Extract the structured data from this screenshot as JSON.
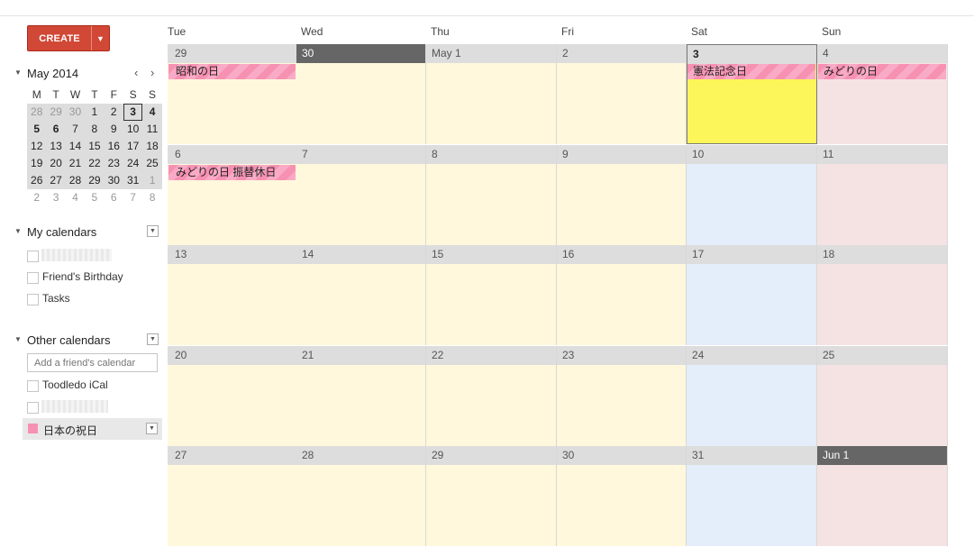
{
  "create": {
    "label": "CREATE",
    "arrow": "▼"
  },
  "mini_calendar": {
    "title": "May 2014",
    "prev": "‹",
    "next": "›",
    "dow": [
      "M",
      "T",
      "W",
      "T",
      "F",
      "S",
      "S"
    ],
    "weeks": [
      [
        "28",
        "29",
        "30",
        "1",
        "2",
        "3",
        "4"
      ],
      [
        "5",
        "6",
        "7",
        "8",
        "9",
        "10",
        "11"
      ],
      [
        "12",
        "13",
        "14",
        "15",
        "16",
        "17",
        "18"
      ],
      [
        "19",
        "20",
        "21",
        "22",
        "23",
        "24",
        "25"
      ],
      [
        "26",
        "27",
        "28",
        "29",
        "30",
        "31",
        "1"
      ],
      [
        "2",
        "3",
        "4",
        "5",
        "6",
        "7",
        "8"
      ]
    ]
  },
  "my_calendars": {
    "title": "My calendars",
    "items": [
      "",
      "Friend's Birthday",
      "Tasks"
    ]
  },
  "other_calendars": {
    "title": "Other calendars",
    "input_placeholder": "Add a friend's calendar",
    "items": [
      "Toodledo iCal",
      ""
    ],
    "highlighted": {
      "label": "日本の祝日",
      "color": "#f691b2"
    }
  },
  "grid": {
    "dow": [
      "Tue",
      "Wed",
      "Thu",
      "Fri",
      "Sat",
      "Sun"
    ],
    "weeks": [
      {
        "days": [
          "29",
          "30",
          "May 1",
          "2",
          "3",
          "4"
        ],
        "events": [
          {
            "col": 0,
            "span": 1,
            "label": "昭和の日"
          },
          {
            "col": 4,
            "span": 1,
            "label": "憲法記念日"
          },
          {
            "col": 5,
            "span": 1,
            "label": "みどりの日"
          }
        ]
      },
      {
        "days": [
          "6",
          "7",
          "8",
          "9",
          "10",
          "11"
        ],
        "events": [
          {
            "col": 0,
            "span": 1,
            "label": "みどりの日 振替休日"
          }
        ]
      },
      {
        "days": [
          "13",
          "14",
          "15",
          "16",
          "17",
          "18"
        ],
        "events": []
      },
      {
        "days": [
          "20",
          "21",
          "22",
          "23",
          "24",
          "25"
        ],
        "events": []
      },
      {
        "days": [
          "27",
          "28",
          "29",
          "30",
          "31",
          "Jun 1"
        ],
        "events": []
      }
    ]
  },
  "colors": {
    "weekday": "#fff8dc",
    "saturday": "#e4eefa",
    "sunday": "#f5e3e3",
    "today": "#fcf65a",
    "event": "#f691b2",
    "create": "#d14836"
  }
}
